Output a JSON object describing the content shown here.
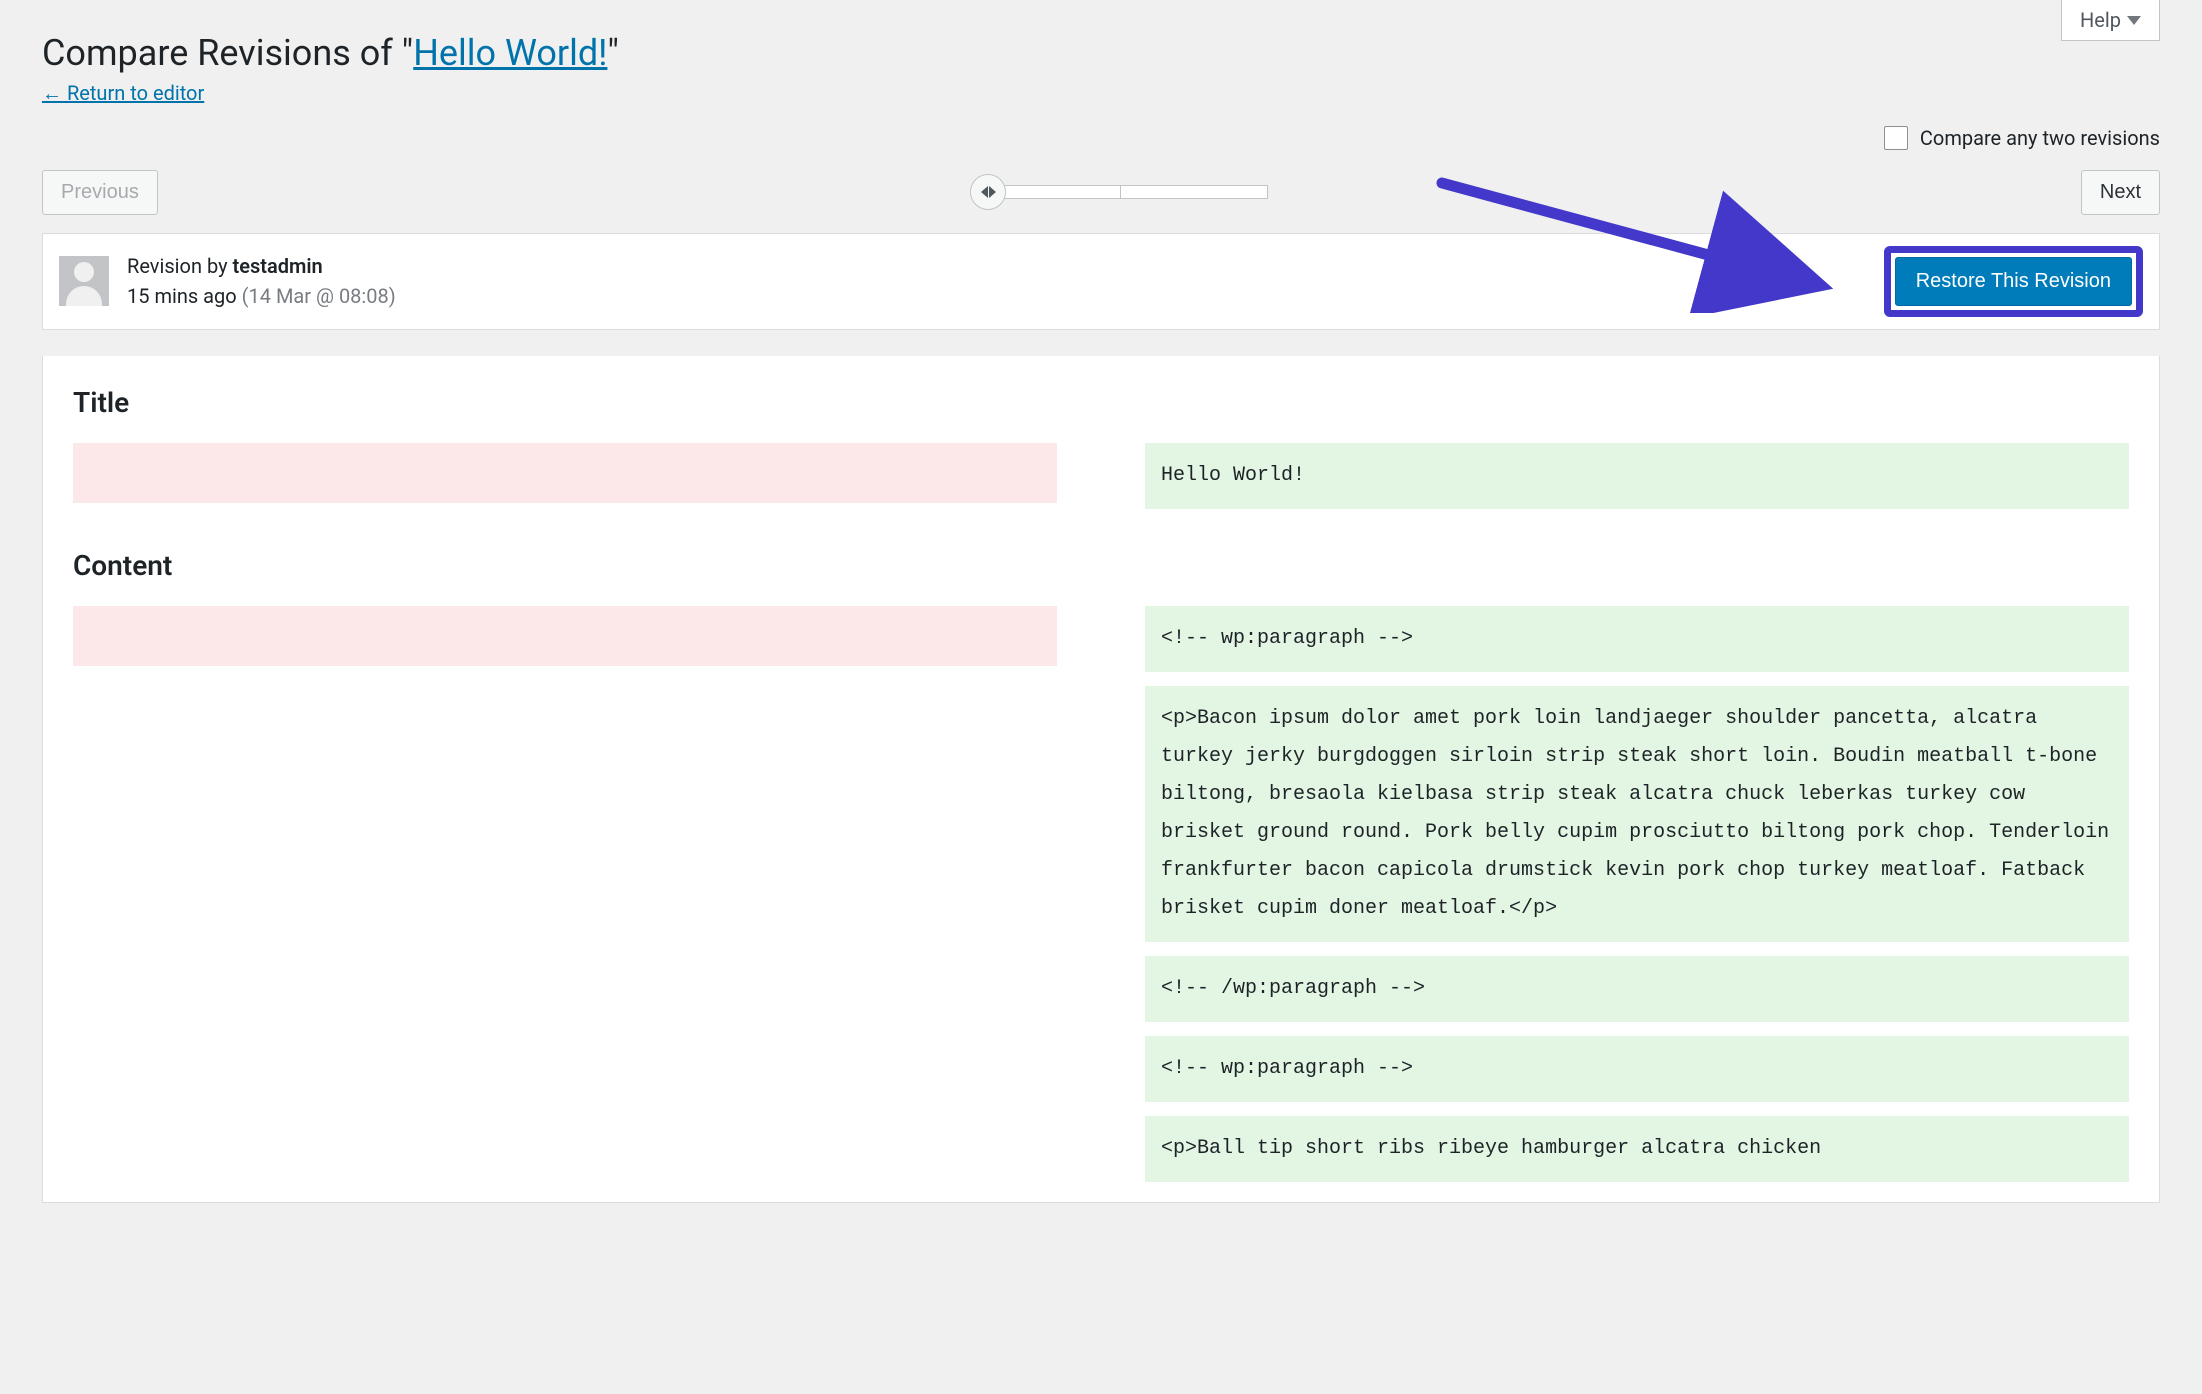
{
  "help_label": "Help",
  "page_title_prefix": "Compare Revisions of \"",
  "page_title_link": "Hello World!",
  "page_title_suffix": "\"",
  "return_link": "← Return to editor",
  "compare_any_label": "Compare any two revisions",
  "prev_label": "Previous",
  "next_label": "Next",
  "revision": {
    "by_prefix": "Revision by ",
    "author": "testadmin",
    "ago": "15 mins ago",
    "date": "(14 Mar @ 08:08)"
  },
  "restore_label": "Restore This Revision",
  "diff": {
    "title_heading": "Title",
    "content_heading": "Content",
    "title_added": "Hello World!",
    "content_added_blocks": [
      "<!-- wp:paragraph -->",
      "<p>Bacon ipsum dolor amet pork loin landjaeger shoulder pancetta, alcatra turkey jerky burgdoggen sirloin strip steak short loin. Boudin meatball t-bone biltong, bresaola kielbasa strip steak alcatra chuck leberkas turkey cow brisket ground round. Pork belly cupim prosciutto biltong pork chop. Tenderloin frankfurter bacon capicola drumstick kevin pork chop turkey meatloaf. Fatback brisket cupim doner meatloaf.</p>",
      "<!-- /wp:paragraph -->",
      "<!-- wp:paragraph -->",
      "<p>Ball tip short ribs ribeye hamburger alcatra chicken"
    ]
  }
}
